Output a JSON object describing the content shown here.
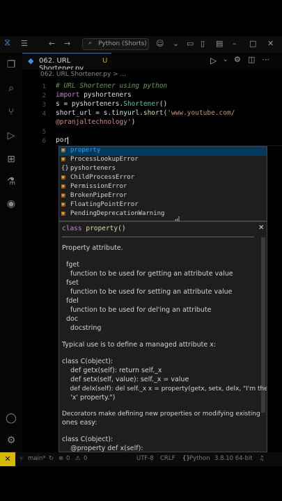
{
  "titlebar": {
    "search_text": "Python (Shorts)"
  },
  "tab": {
    "label": "062. URL Shortener.py",
    "modified": "U"
  },
  "breadcrumb": {
    "text": "062. URL Shortener.py > ..."
  },
  "code": {
    "line_numbers": [
      "1",
      "2",
      "3",
      "4",
      "5",
      "6",
      "7"
    ],
    "comment": "# URL Shortener using python",
    "import_kw": "import",
    "import_mod": "pyshorteners",
    "l3_a": "s = pyshorteners.",
    "l3_cls": "Shortener",
    "l3_b": "()",
    "l4_a": "short_url = s.tinyurl.",
    "l4_fn": "short",
    "l4_b": "(",
    "l4_str": "'www.youtube.com/",
    "l4_cont": "@pranjaltechnology'",
    "l4_end": ")",
    "l7": "por"
  },
  "suggest": {
    "items": [
      {
        "pre": "",
        "hl": "p",
        "mid": "r",
        "hl2": "o",
        "post": "perty",
        "full": "property",
        "icon": "{}"
      },
      {
        "full": "ProcessLookupError"
      },
      {
        "full": "pyshorteners"
      },
      {
        "full": "ChildProcessError"
      },
      {
        "full": "PermissionError"
      },
      {
        "full": "BrokenPipeError"
      },
      {
        "full": "FloatingPointError"
      },
      {
        "full": "PendingDeprecationWarning"
      }
    ]
  },
  "docs": {
    "signature_kw": "class",
    "signature_fn": "property",
    "signature_end": "()",
    "title": "Property attribute.",
    "fget": "fget",
    "fget_desc": "  function to be used for getting an attribute value",
    "fset": "fset",
    "fset_desc": "  function to be used for setting an attribute value",
    "fdel": "fdel",
    "fdel_desc": "  function to be used for del'ing an attribute",
    "doc": "doc",
    "doc_desc": "  docstring",
    "typical": "Typical use is to define a managed attribute x:",
    "c1": "class C(object):",
    "c2": "    def getx(self): return self._x",
    "c3": "    def setx(self, value): self._x = value",
    "c4": "    def delx(self): del self._x x = property(getx, setx, delx, \"I'm the",
    "c5": "    'x' property.\")",
    "dec1": "Decorators make defining new properties or modifying existing",
    "dec2": "ones easy:",
    "c6": "class C(object):",
    "c7": "    @property def x(self):"
  },
  "status": {
    "branch": "main*",
    "errors": "0",
    "warnings": "0",
    "encoding": "UTF-8",
    "eol": "CRLF",
    "language": "Python",
    "interpreter": "3.8.10 64-bit"
  }
}
